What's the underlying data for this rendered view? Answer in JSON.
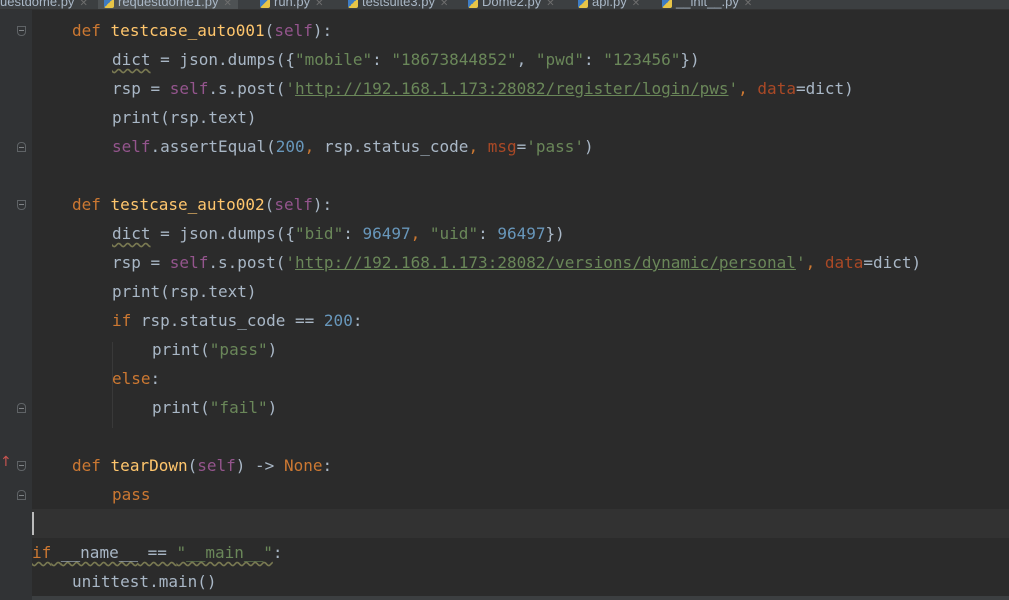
{
  "tabs": [
    {
      "label": "uestdome.py",
      "active": false
    },
    {
      "label": "requestdome1.py",
      "active": true
    },
    {
      "label": "run.py",
      "active": false
    },
    {
      "label": "testsuite3.py",
      "active": false
    },
    {
      "label": "Dome2.py",
      "active": false
    },
    {
      "label": "api.py",
      "active": false
    },
    {
      "label": "__init__.py",
      "active": false
    }
  ],
  "code": {
    "l1": {
      "def": "def",
      "name": "testcase_auto001",
      "self": "self"
    },
    "l2": {
      "var": "dict",
      "call": " = json.dumps({",
      "k1": "\"mobile\"",
      "v1": "\"18673844852\"",
      "k2": "\"pwd\"",
      "v2": "\"123456\"",
      "end": "})"
    },
    "l3": {
      "pre": "rsp = ",
      "self": "self",
      "mid": ".s.post(",
      "url": "http://192.168.1.173:28082/register/login/pws",
      "param": "data",
      "end": "=dict)"
    },
    "l4": {
      "text": "print(rsp.text)"
    },
    "l5": {
      "self": "self",
      "mid": ".assertEqual(",
      "num": "200",
      "mid2": "rsp.status_code",
      "param": "msg",
      "val": "'pass'",
      "end": ")"
    },
    "l6": {
      "def": "def",
      "name": "testcase_auto002",
      "self": "self"
    },
    "l7": {
      "var": "dict",
      "call": " = json.dumps({",
      "k1": "\"bid\"",
      "v1": "96497",
      "k2": "\"uid\"",
      "v2": "96497",
      "end": "})"
    },
    "l8": {
      "pre": "rsp = ",
      "self": "self",
      "mid": ".s.post(",
      "url": "http://192.168.1.173:28082/versions/dynamic/personal",
      "param": "data",
      "end": "=dict)"
    },
    "l9": {
      "text": "print(rsp.text)"
    },
    "l10": {
      "kw": "if",
      "mid": " rsp.status_code == ",
      "num": "200",
      "end": ":"
    },
    "l11": {
      "fn": "print(",
      "str": "\"pass\"",
      "end": ")"
    },
    "l12": {
      "kw": "else",
      "end": ":"
    },
    "l13": {
      "fn": "print(",
      "str": "\"fail\"",
      "end": ")"
    },
    "l14": {
      "def": "def",
      "name": "tearDown",
      "self": "self",
      "ret": "None"
    },
    "l15": {
      "kw": "pass"
    },
    "l16": {
      "kw": "if",
      "name": "__name__",
      "str": "\"__main__\""
    },
    "l17": {
      "text": "unittest.main()"
    }
  }
}
